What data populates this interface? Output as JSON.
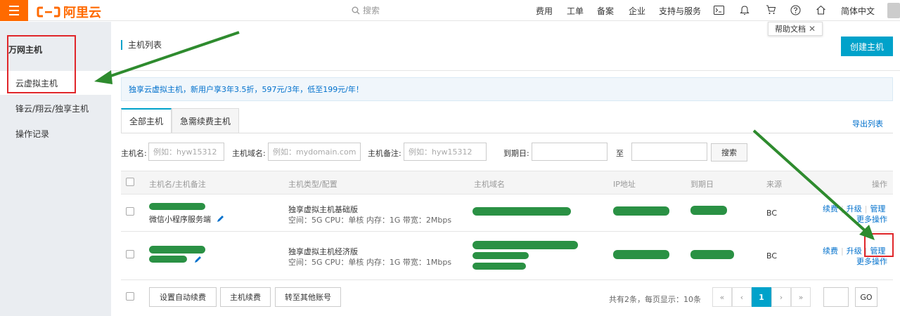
{
  "header": {
    "logo_text": "阿里云",
    "search_placeholder": "搜索",
    "nav": [
      "费用",
      "工单",
      "备案",
      "企业",
      "支持与服务"
    ],
    "language": "简体中文",
    "tooltip_text": "帮助文档"
  },
  "sidebar": {
    "title": "万网主机",
    "items": [
      {
        "label": "云虚拟主机",
        "active": true
      },
      {
        "label": "锋云/翔云/独享主机",
        "active": false
      },
      {
        "label": "操作记录",
        "active": false
      }
    ]
  },
  "main": {
    "title": "主机列表",
    "create_button": "创建主机",
    "promo": "独享云虚拟主机，新用户享3年3.5折，597元/3年，低至199元/年！",
    "tabs": [
      "全部主机",
      "急需续费主机"
    ],
    "export_label": "导出列表",
    "filters": {
      "hostname_label": "主机名:",
      "hostname_placeholder": "例如：hyw15312",
      "domain_label": "主机域名:",
      "domain_placeholder": "例如：mydomain.com",
      "note_label": "主机备注:",
      "note_placeholder": "例如：hyw15312",
      "expire_label": "到期日:",
      "to_label": "至",
      "search_button": "搜索"
    },
    "table": {
      "columns": [
        "主机名/主机备注",
        "主机类型/配置",
        "主机域名",
        "IP地址",
        "到期日",
        "来源",
        "操作"
      ],
      "rows": [
        {
          "name_note": "微信小程序服务端",
          "type": "独享虚拟主机基础版",
          "config": "空间：5G CPU：单核 内存：1G 带宽：2Mbps",
          "source": "BC",
          "actions": [
            "续费",
            "升级",
            "管理"
          ],
          "more": "更多操作"
        },
        {
          "name_note": "",
          "type": "独享虚拟主机经济版",
          "config": "空间：5G CPU：单核 内存：1G 带宽：1Mbps",
          "source": "BC",
          "actions": [
            "续费",
            "升级",
            "管理"
          ],
          "more": "更多操作"
        }
      ]
    },
    "footer": {
      "buttons": [
        "设置自动续费",
        "主机续费",
        "转至其他账号"
      ],
      "summary": "共有2条，每页显示：10条",
      "pages": [
        "«",
        "‹",
        "1",
        "›",
        "»"
      ],
      "go_label": "GO"
    }
  },
  "colors": {
    "brand": "#ff6a00",
    "accent": "#00a2ca",
    "link": "#0070cc",
    "annotation": "#e0262a",
    "arrow": "#2e8b2e"
  }
}
